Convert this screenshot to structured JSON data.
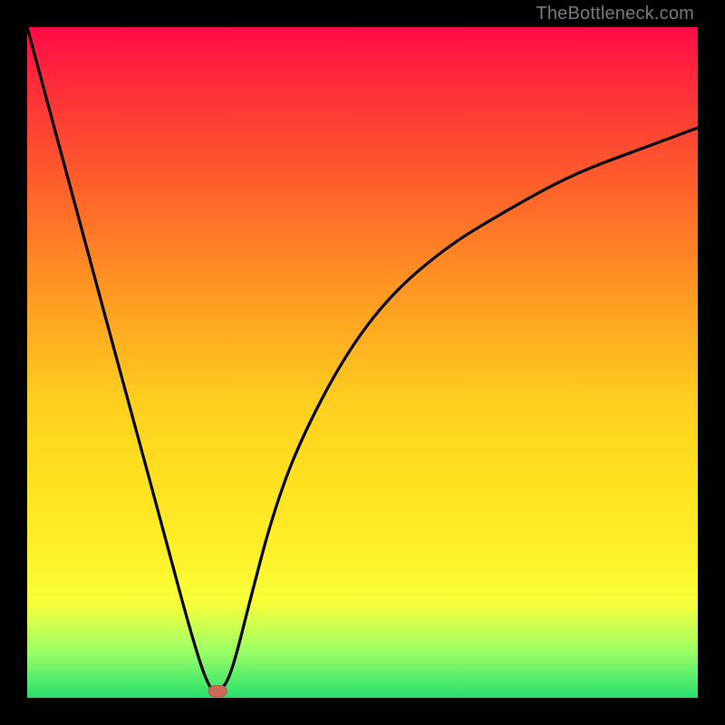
{
  "watermark": "TheBottleneck.com",
  "colors": {
    "frame": "#000000",
    "curve": "#000000",
    "marker_fill": "#cc6b5a",
    "marker_stroke": "#b25647"
  },
  "chart_data": {
    "type": "line",
    "title": "",
    "xlabel": "",
    "ylabel": "",
    "xlim": [
      0,
      100
    ],
    "ylim": [
      0,
      100
    ],
    "legend": false,
    "grid": false,
    "series": [
      {
        "name": "left-branch",
        "x": [
          0,
          5.4,
          10.8,
          16.2,
          20.3,
          24.3,
          27.0,
          28.4
        ],
        "y": [
          100,
          80,
          60,
          40,
          25,
          10,
          1.5,
          1
        ]
      },
      {
        "name": "right-branch",
        "x": [
          28.4,
          29.7,
          31.1,
          33.1,
          36.5,
          40.5,
          47.3,
          54.1,
          62.2,
          70.3,
          81.1,
          91.9,
          100
        ],
        "y": [
          1,
          2,
          6,
          14,
          27,
          38,
          51,
          60,
          67,
          72,
          78,
          82,
          85
        ]
      }
    ],
    "marker": {
      "name": "minimum-point",
      "x": 28.4,
      "y": 1,
      "shape": "rounded-pill"
    },
    "background_gradient": {
      "orientation": "vertical",
      "stops": [
        {
          "pos": 0.0,
          "color": "#ff0b45"
        },
        {
          "pos": 0.08,
          "color": "#ff2a3a"
        },
        {
          "pos": 0.22,
          "color": "#ff5a2c"
        },
        {
          "pos": 0.4,
          "color": "#ff9a22"
        },
        {
          "pos": 0.56,
          "color": "#ffcf1f"
        },
        {
          "pos": 0.68,
          "color": "#ffe21f"
        },
        {
          "pos": 0.78,
          "color": "#fff028"
        },
        {
          "pos": 0.86,
          "color": "#f7ff3a"
        },
        {
          "pos": 0.93,
          "color": "#9cff66"
        },
        {
          "pos": 1.0,
          "color": "#27e06e"
        }
      ]
    }
  }
}
